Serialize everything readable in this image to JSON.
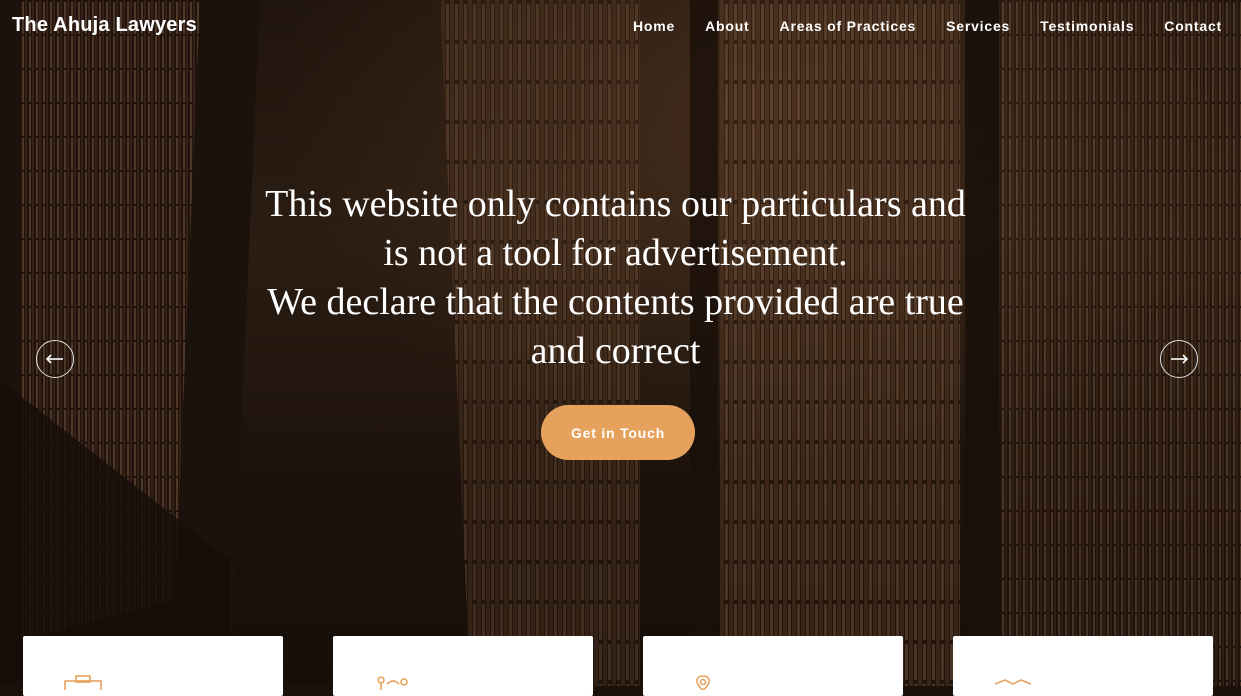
{
  "header": {
    "brand": "The Ahuja Lawyers",
    "nav": [
      "Home",
      "About",
      "Areas of Practices",
      "Services",
      "Testimonials",
      "Contact"
    ]
  },
  "hero": {
    "line1": "This website only contains our particulars and is not a tool for advertisement.",
    "line2": "We declare that the contents provided are true and correct",
    "cta": "Get in Touch"
  },
  "cards": [
    {
      "icon": "briefcase-icon"
    },
    {
      "icon": "scales-icon"
    },
    {
      "icon": "location-pin-icon"
    },
    {
      "icon": "handshake-icon"
    }
  ],
  "colors": {
    "accent": "#e6a25c",
    "text": "#ffffff"
  }
}
